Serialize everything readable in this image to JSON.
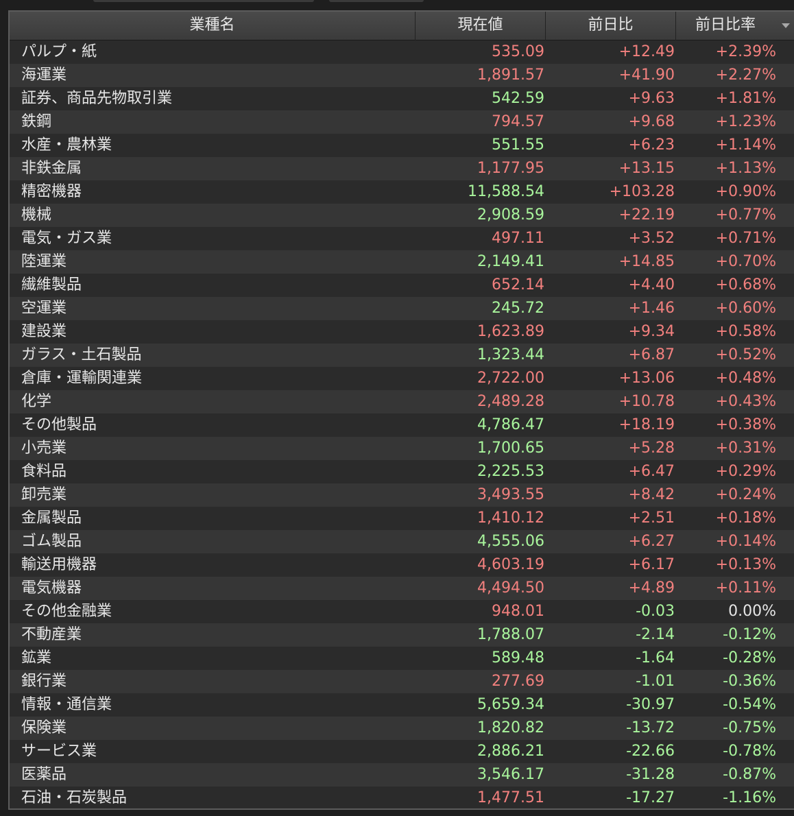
{
  "colors": {
    "up": "#f2807e",
    "down": "#a9f59c",
    "neutral": "#e6e6e6",
    "header_bg": "#444444",
    "row_odd": "#2b2b2b",
    "row_even": "#363636"
  },
  "header": {
    "col_name": "業種名",
    "col_price": "現在値",
    "col_change": "前日比",
    "col_change_rate": "前日比率",
    "sort_icon": "sort-descending-icon"
  },
  "rows": [
    {
      "name": "パルプ・紙",
      "price": "535.09",
      "price_dir": "up",
      "change": "+12.49",
      "change_dir": "up",
      "rate": "+2.39%",
      "rate_dir": "up"
    },
    {
      "name": "海運業",
      "price": "1,891.57",
      "price_dir": "up",
      "change": "+41.90",
      "change_dir": "up",
      "rate": "+2.27%",
      "rate_dir": "up"
    },
    {
      "name": "証券、商品先物取引業",
      "price": "542.59",
      "price_dir": "down",
      "change": "+9.63",
      "change_dir": "up",
      "rate": "+1.81%",
      "rate_dir": "up"
    },
    {
      "name": "鉄鋼",
      "price": "794.57",
      "price_dir": "up",
      "change": "+9.68",
      "change_dir": "up",
      "rate": "+1.23%",
      "rate_dir": "up"
    },
    {
      "name": "水産・農林業",
      "price": "551.55",
      "price_dir": "down",
      "change": "+6.23",
      "change_dir": "up",
      "rate": "+1.14%",
      "rate_dir": "up"
    },
    {
      "name": "非鉄金属",
      "price": "1,177.95",
      "price_dir": "up",
      "change": "+13.15",
      "change_dir": "up",
      "rate": "+1.13%",
      "rate_dir": "up"
    },
    {
      "name": "精密機器",
      "price": "11,588.54",
      "price_dir": "down",
      "change": "+103.28",
      "change_dir": "up",
      "rate": "+0.90%",
      "rate_dir": "up"
    },
    {
      "name": "機械",
      "price": "2,908.59",
      "price_dir": "down",
      "change": "+22.19",
      "change_dir": "up",
      "rate": "+0.77%",
      "rate_dir": "up"
    },
    {
      "name": "電気・ガス業",
      "price": "497.11",
      "price_dir": "up",
      "change": "+3.52",
      "change_dir": "up",
      "rate": "+0.71%",
      "rate_dir": "up"
    },
    {
      "name": "陸運業",
      "price": "2,149.41",
      "price_dir": "down",
      "change": "+14.85",
      "change_dir": "up",
      "rate": "+0.70%",
      "rate_dir": "up"
    },
    {
      "name": "繊維製品",
      "price": "652.14",
      "price_dir": "up",
      "change": "+4.40",
      "change_dir": "up",
      "rate": "+0.68%",
      "rate_dir": "up"
    },
    {
      "name": "空運業",
      "price": "245.72",
      "price_dir": "down",
      "change": "+1.46",
      "change_dir": "up",
      "rate": "+0.60%",
      "rate_dir": "up"
    },
    {
      "name": "建設業",
      "price": "1,623.89",
      "price_dir": "up",
      "change": "+9.34",
      "change_dir": "up",
      "rate": "+0.58%",
      "rate_dir": "up"
    },
    {
      "name": "ガラス・土石製品",
      "price": "1,323.44",
      "price_dir": "down",
      "change": "+6.87",
      "change_dir": "up",
      "rate": "+0.52%",
      "rate_dir": "up"
    },
    {
      "name": "倉庫・運輸関連業",
      "price": "2,722.00",
      "price_dir": "up",
      "change": "+13.06",
      "change_dir": "up",
      "rate": "+0.48%",
      "rate_dir": "up"
    },
    {
      "name": "化学",
      "price": "2,489.28",
      "price_dir": "up",
      "change": "+10.78",
      "change_dir": "up",
      "rate": "+0.43%",
      "rate_dir": "up"
    },
    {
      "name": "その他製品",
      "price": "4,786.47",
      "price_dir": "down",
      "change": "+18.19",
      "change_dir": "up",
      "rate": "+0.38%",
      "rate_dir": "up"
    },
    {
      "name": "小売業",
      "price": "1,700.65",
      "price_dir": "down",
      "change": "+5.28",
      "change_dir": "up",
      "rate": "+0.31%",
      "rate_dir": "up"
    },
    {
      "name": "食料品",
      "price": "2,225.53",
      "price_dir": "down",
      "change": "+6.47",
      "change_dir": "up",
      "rate": "+0.29%",
      "rate_dir": "up"
    },
    {
      "name": "卸売業",
      "price": "3,493.55",
      "price_dir": "up",
      "change": "+8.42",
      "change_dir": "up",
      "rate": "+0.24%",
      "rate_dir": "up"
    },
    {
      "name": "金属製品",
      "price": "1,410.12",
      "price_dir": "up",
      "change": "+2.51",
      "change_dir": "up",
      "rate": "+0.18%",
      "rate_dir": "up"
    },
    {
      "name": "ゴム製品",
      "price": "4,555.06",
      "price_dir": "down",
      "change": "+6.27",
      "change_dir": "up",
      "rate": "+0.14%",
      "rate_dir": "up"
    },
    {
      "name": "輸送用機器",
      "price": "4,603.19",
      "price_dir": "up",
      "change": "+6.17",
      "change_dir": "up",
      "rate": "+0.13%",
      "rate_dir": "up"
    },
    {
      "name": "電気機器",
      "price": "4,494.50",
      "price_dir": "up",
      "change": "+4.89",
      "change_dir": "up",
      "rate": "+0.11%",
      "rate_dir": "up"
    },
    {
      "name": "その他金融業",
      "price": "948.01",
      "price_dir": "up",
      "change": "-0.03",
      "change_dir": "down",
      "rate": "0.00%",
      "rate_dir": "neutral"
    },
    {
      "name": "不動産業",
      "price": "1,788.07",
      "price_dir": "down",
      "change": "-2.14",
      "change_dir": "down",
      "rate": "-0.12%",
      "rate_dir": "down"
    },
    {
      "name": "鉱業",
      "price": "589.48",
      "price_dir": "down",
      "change": "-1.64",
      "change_dir": "down",
      "rate": "-0.28%",
      "rate_dir": "down"
    },
    {
      "name": "銀行業",
      "price": "277.69",
      "price_dir": "up",
      "change": "-1.01",
      "change_dir": "down",
      "rate": "-0.36%",
      "rate_dir": "down"
    },
    {
      "name": "情報・通信業",
      "price": "5,659.34",
      "price_dir": "down",
      "change": "-30.97",
      "change_dir": "down",
      "rate": "-0.54%",
      "rate_dir": "down"
    },
    {
      "name": "保険業",
      "price": "1,820.82",
      "price_dir": "down",
      "change": "-13.72",
      "change_dir": "down",
      "rate": "-0.75%",
      "rate_dir": "down"
    },
    {
      "name": "サービス業",
      "price": "2,886.21",
      "price_dir": "down",
      "change": "-22.66",
      "change_dir": "down",
      "rate": "-0.78%",
      "rate_dir": "down"
    },
    {
      "name": "医薬品",
      "price": "3,546.17",
      "price_dir": "down",
      "change": "-31.28",
      "change_dir": "down",
      "rate": "-0.87%",
      "rate_dir": "down"
    },
    {
      "name": "石油・石炭製品",
      "price": "1,477.51",
      "price_dir": "up",
      "change": "-17.27",
      "change_dir": "down",
      "rate": "-1.16%",
      "rate_dir": "down"
    }
  ]
}
